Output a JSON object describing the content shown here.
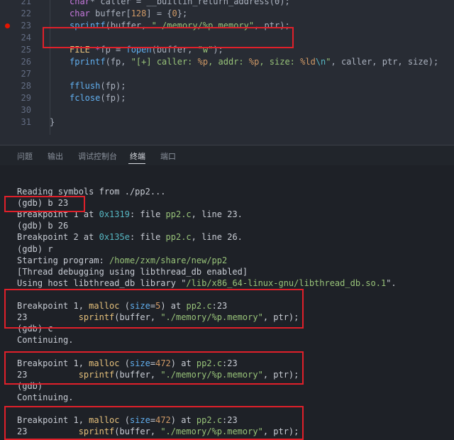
{
  "editor": {
    "lines": [
      {
        "num": "21",
        "segments": [
          [
            "kw",
            "char"
          ],
          [
            "",
            "* caller = __builtin_return_address(0);"
          ]
        ]
      },
      {
        "num": "22",
        "segments": [
          [
            "kw",
            "char"
          ],
          [
            "",
            " buffer["
          ],
          [
            "nu",
            "128"
          ],
          [
            "",
            "] = {"
          ],
          [
            "nu",
            "0"
          ],
          [
            "",
            "};"
          ]
        ]
      },
      {
        "num": "23",
        "segments": [
          [
            "fn",
            "sprintf"
          ],
          [
            "",
            "(buffer, "
          ],
          [
            "st",
            "\"./memory/%p.memory\""
          ],
          [
            "",
            ", ptr);"
          ]
        ]
      },
      {
        "num": "24",
        "segments": []
      },
      {
        "num": "25",
        "segments": [
          [
            "ty",
            "FILE"
          ],
          [
            "kw",
            " *"
          ],
          [
            "",
            "fp = "
          ],
          [
            "fn",
            "fopen"
          ],
          [
            "",
            "(buffer, "
          ],
          [
            "st",
            "\"w\""
          ],
          [
            "",
            ");"
          ]
        ]
      },
      {
        "num": "26",
        "segments": [
          [
            "fn",
            "fprintf"
          ],
          [
            "",
            "(fp, "
          ],
          [
            "st",
            "\"[+] caller: "
          ],
          [
            "nu",
            "%p"
          ],
          [
            "st",
            ", addr: "
          ],
          [
            "nu",
            "%p"
          ],
          [
            "st",
            ", size: "
          ],
          [
            "nu",
            "%ld"
          ],
          [
            "es",
            "\\n"
          ],
          [
            "st",
            "\""
          ],
          [
            "",
            ", caller, ptr, size);"
          ]
        ]
      },
      {
        "num": "27",
        "segments": []
      },
      {
        "num": "28",
        "segments": [
          [
            "fn",
            "fflush"
          ],
          [
            "",
            "(fp);"
          ]
        ]
      },
      {
        "num": "29",
        "segments": [
          [
            "fn",
            "fclose"
          ],
          [
            "",
            "(fp);"
          ]
        ]
      },
      {
        "num": "30",
        "segments": []
      },
      {
        "num": "31",
        "segments": [
          [
            "",
            "}"
          ]
        ]
      }
    ]
  },
  "tabs": [
    "问题",
    "输出",
    "调试控制台",
    "终端",
    "端口"
  ],
  "active_tab_index": 3,
  "terminal": {
    "lines": [
      {
        "segments": [
          [
            "",
            "Reading symbols from ./pp2..."
          ]
        ]
      },
      {
        "segments": [
          [
            "",
            "(gdb) b 23"
          ]
        ]
      },
      {
        "segments": [
          [
            "",
            "Breakpoint 1 at "
          ],
          [
            "t-addr",
            "0x1319"
          ],
          [
            "",
            ": file "
          ],
          [
            "t-file",
            "pp2.c"
          ],
          [
            "",
            ", line 23."
          ]
        ]
      },
      {
        "segments": [
          [
            "",
            "(gdb) b 26"
          ]
        ]
      },
      {
        "segments": [
          [
            "",
            "Breakpoint 2 at "
          ],
          [
            "t-addr",
            "0x135e"
          ],
          [
            "",
            ": file "
          ],
          [
            "t-file",
            "pp2.c"
          ],
          [
            "",
            ", line 26."
          ]
        ]
      },
      {
        "segments": [
          [
            "",
            "(gdb) r"
          ]
        ]
      },
      {
        "segments": [
          [
            "",
            "Starting program: "
          ],
          [
            "t-path",
            "/home/zxm/share/new/pp2"
          ]
        ]
      },
      {
        "segments": [
          [
            "",
            "[Thread debugging using libthread_db enabled]"
          ]
        ]
      },
      {
        "segments": [
          [
            "",
            "Using host libthread_db library \""
          ],
          [
            "t-path",
            "/lib/x86_64-linux-gnu/libthread_db.so.1"
          ],
          [
            "",
            "\"."
          ]
        ]
      },
      {
        "segments": []
      },
      {
        "segments": [
          [
            "",
            "Breakpoint 1, "
          ],
          [
            "t-fn",
            "malloc"
          ],
          [
            "",
            " ("
          ],
          [
            "t-var",
            "size"
          ],
          [
            "",
            "="
          ],
          [
            "t-num",
            "5"
          ],
          [
            "",
            ") at "
          ],
          [
            "t-file",
            "pp2.c"
          ],
          [
            "",
            ":23"
          ]
        ]
      },
      {
        "segments": [
          [
            "",
            "23          "
          ],
          [
            "t-fn",
            "sprintf"
          ],
          [
            "",
            "(buffer, "
          ],
          [
            "t-path",
            "\"./memory/%p.memory\""
          ],
          [
            "",
            ", ptr);"
          ]
        ]
      },
      {
        "segments": [
          [
            "",
            "(gdb) c"
          ]
        ]
      },
      {
        "segments": [
          [
            "",
            "Continuing."
          ]
        ]
      },
      {
        "segments": []
      },
      {
        "segments": [
          [
            "",
            "Breakpoint 1, "
          ],
          [
            "t-fn",
            "malloc"
          ],
          [
            "",
            " ("
          ],
          [
            "t-var",
            "size"
          ],
          [
            "",
            "="
          ],
          [
            "t-num",
            "472"
          ],
          [
            "",
            ") at "
          ],
          [
            "t-file",
            "pp2.c"
          ],
          [
            "",
            ":23"
          ]
        ]
      },
      {
        "segments": [
          [
            "",
            "23          "
          ],
          [
            "t-fn",
            "sprintf"
          ],
          [
            "",
            "(buffer, "
          ],
          [
            "t-path",
            "\"./memory/%p.memory\""
          ],
          [
            "",
            ", ptr);"
          ]
        ]
      },
      {
        "segments": [
          [
            "",
            "(gdb)"
          ]
        ]
      },
      {
        "segments": [
          [
            "",
            "Continuing."
          ]
        ]
      },
      {
        "segments": []
      },
      {
        "segments": [
          [
            "",
            "Breakpoint 1, "
          ],
          [
            "t-fn",
            "malloc"
          ],
          [
            "",
            " ("
          ],
          [
            "t-var",
            "size"
          ],
          [
            "",
            "="
          ],
          [
            "t-num",
            "472"
          ],
          [
            "",
            ") at "
          ],
          [
            "t-file",
            "pp2.c"
          ],
          [
            "",
            ":23"
          ]
        ]
      },
      {
        "segments": [
          [
            "",
            "23          "
          ],
          [
            "t-fn",
            "sprintf"
          ],
          [
            "",
            "(buffer, "
          ],
          [
            "t-path",
            "\"./memory/%p.memory\""
          ],
          [
            "",
            ", ptr);"
          ]
        ]
      }
    ]
  },
  "colors": {
    "breakpoint": "#e51400",
    "highlight_box": "#e0202a",
    "editor_bg": "#282c34",
    "terminal_bg": "#1e2127"
  }
}
